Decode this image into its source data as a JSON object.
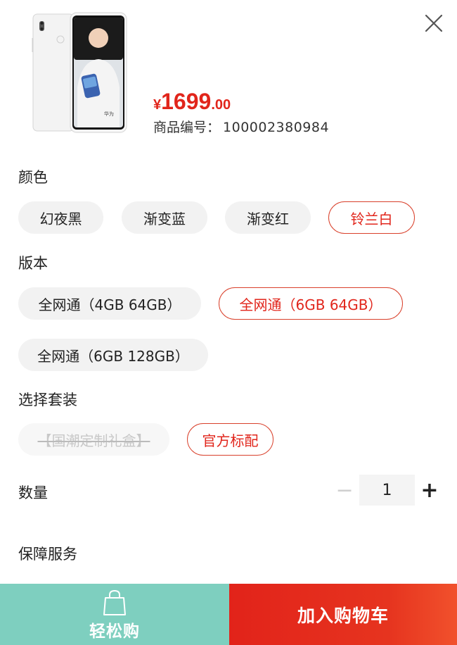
{
  "close_icon": "close-icon",
  "product": {
    "price_currency": "¥",
    "price_integer": "1699",
    "price_decimal": ".00",
    "sku_label": "商品编号：",
    "sku_value": "100002380984",
    "price_color": "#e1251b"
  },
  "sections": {
    "color": "颜色",
    "version": "版本",
    "package": "选择套装",
    "quantity": "数量",
    "service": "保障服务"
  },
  "color_options": [
    "幻夜黑",
    "渐变蓝",
    "渐变红",
    "铃兰白"
  ],
  "color_selected": "铃兰白",
  "version_options": [
    "全网通（4GB 64GB）",
    "全网通（6GB 64GB）",
    "全网通（6GB 128GB）"
  ],
  "version_selected": "全网通（6GB 64GB）",
  "package_options": [
    "【国潮定制礼盒】",
    "官方标配"
  ],
  "package_selected": "官方标配",
  "package_disabled": "【国潮定制礼盒】",
  "quantity": {
    "minus": "−",
    "value": "1",
    "plus": "+"
  },
  "bottom": {
    "easy_buy": "轻松购",
    "add_to_cart": "加入购物车",
    "easy_buy_color": "#7ecfbf",
    "cart_color": "#e2231a",
    "bag_icon": "shopping-bag-icon"
  }
}
